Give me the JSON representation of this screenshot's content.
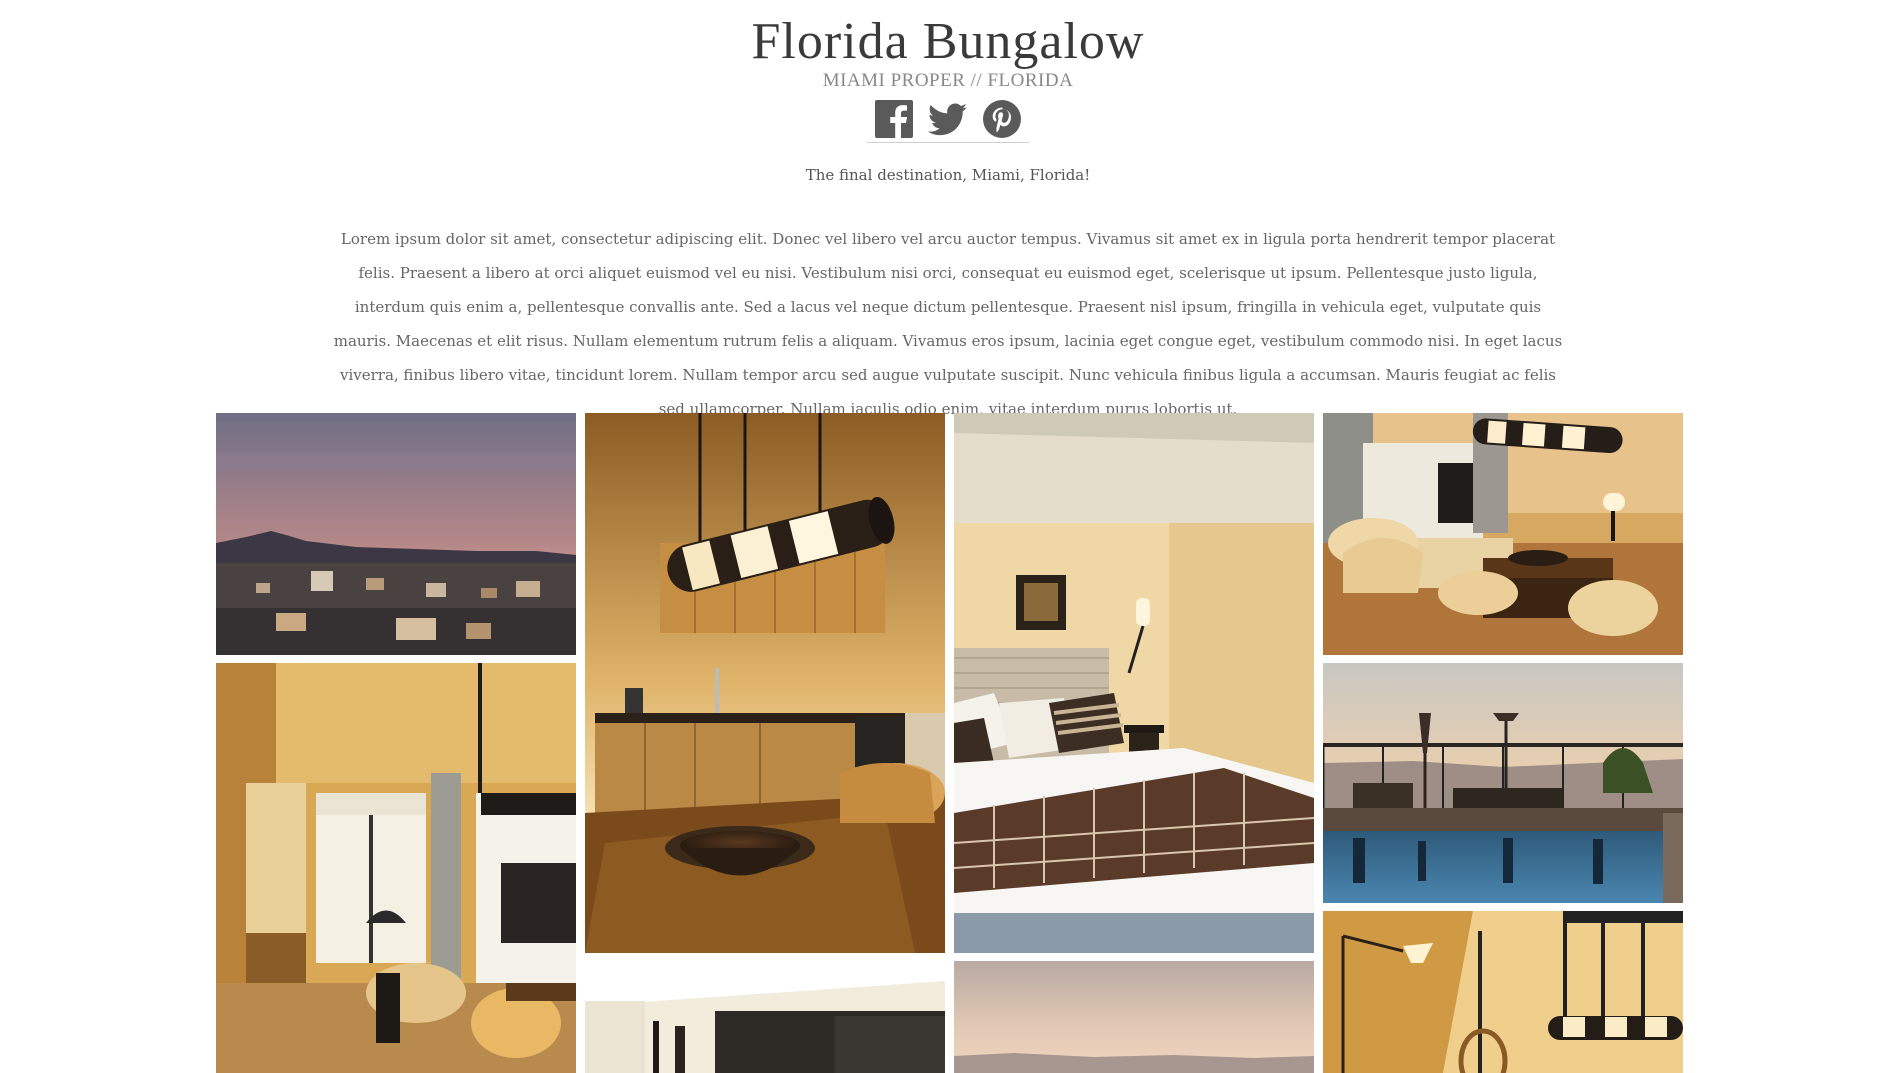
{
  "header": {
    "title": "Florida Bungalow",
    "subtitle": "MIAMI PROPER // FLORIDA"
  },
  "social": {
    "icons": [
      "facebook-icon",
      "twitter-icon",
      "pinterest-icon"
    ],
    "icon_color": "#555555"
  },
  "intro": {
    "tagline": "The final destination, Miami, Florida!",
    "description": "Lorem ipsum dolor sit amet, consectetur adipiscing elit. Donec vel libero vel arcu auctor tempus. Vivamus sit amet ex in ligula porta hendrerit tempor placerat felis. Praesent a libero at orci aliquet euismod vel eu nisi. Vestibulum nisi orci, consequat eu euismod eget, scelerisque ut ipsum. Pellentesque justo ligula, interdum quis enim a, pellentesque convallis ante. Sed a lacus vel neque dictum pellentesque. Praesent nisl ipsum, fringilla in vehicula eget, vulputate quis mauris. Maecenas et elit risus. Nullam elementum rutrum felis a aliquam. Vivamus eros ipsum, lacinia eget congue eget, vestibulum commodo nisi. In eget lacus viverra, finibus libero vitae, tincidunt lorem. Nullam tempor arcu sed augue vulputate suscipit. Nunc vehicula finibus ligula a accumsan. Mauris feugiat ac felis sed ullamcorper. Nullam iaculis odio enim, vitae interdum purus lobortis ut."
  },
  "gallery": {
    "photos": [
      "city-sunset-photo",
      "kitchen-photo",
      "bedroom-photo",
      "living-room-photo",
      "hallway-kitchen-photo",
      "rooftop-pool-photo",
      "dining-pendant-photo",
      "lounge-partial-photo",
      "skyline-partial-photo"
    ]
  }
}
